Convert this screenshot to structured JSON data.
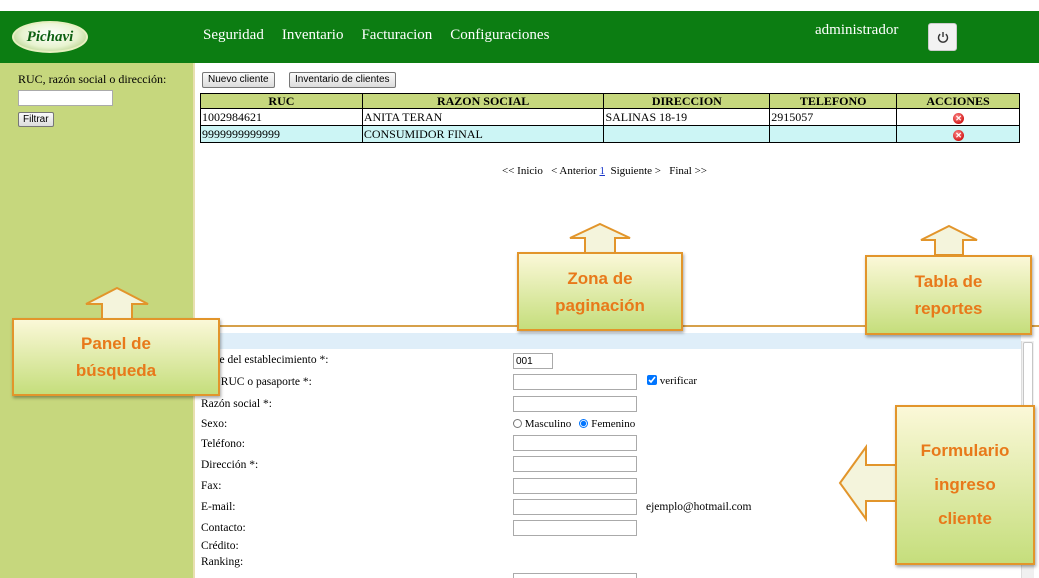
{
  "header": {
    "logo_text": "Pichavi",
    "nav": [
      "Seguridad",
      "Inventario",
      "Facturacion",
      "Configuraciones"
    ],
    "username": "administrador",
    "power_icon": "power-icon"
  },
  "sidebar": {
    "search_label": "RUC, razón social o dirección:",
    "search_value": "",
    "filter_button": "Filtrar"
  },
  "toolbar": {
    "new_client": "Nuevo cliente",
    "inventory": "Inventario de clientes"
  },
  "table": {
    "columns": [
      "RUC",
      "RAZON SOCIAL",
      "DIRECCION",
      "TELEFONO",
      "ACCIONES"
    ],
    "rows": [
      {
        "ruc": "1002984621",
        "razon": "ANITA TERAN",
        "direccion": "SALINAS 18-19",
        "telefono": "2915057"
      },
      {
        "ruc": "9999999999999",
        "razon": "CONSUMIDOR FINAL",
        "direccion": "",
        "telefono": ""
      }
    ],
    "delete_icon": "delete-icon"
  },
  "pager": {
    "first": "<< Inicio",
    "prev": "< Anterior",
    "page": "1",
    "next": "Siguiente >",
    "last": "Final >>"
  },
  "form": {
    "establecimiento_label": "mbre del establecimiento *:",
    "establecimiento_value": "001",
    "cedula_label": "ula, RUC o pasaporte *:",
    "verify_label": "verificar",
    "verify_checked": true,
    "razon_label": "Razón social *:",
    "sexo_label": "Sexo:",
    "sexo_options": [
      "Masculino",
      "Femenino"
    ],
    "sexo_selected": "Femenino",
    "telefono_label": "Teléfono:",
    "direccion_label": "Dirección *:",
    "fax_label": "Fax:",
    "email_label": "E-mail:",
    "email_hint": "ejemplo@hotmail.com",
    "contacto_label": "Contacto:",
    "credito_label": "Crédito:",
    "ranking_label": "Ranking:"
  },
  "callouts": {
    "panel": "Panel de búsqueda",
    "paginacion": "Zona de paginación",
    "reportes": "Tabla de reportes",
    "formulario": "Formulario ingreso cliente"
  },
  "colors": {
    "topbar": "#0c7d12",
    "sidebar": "#c6d77d",
    "callout_text": "#e8791a",
    "callout_border": "#e2952b"
  }
}
